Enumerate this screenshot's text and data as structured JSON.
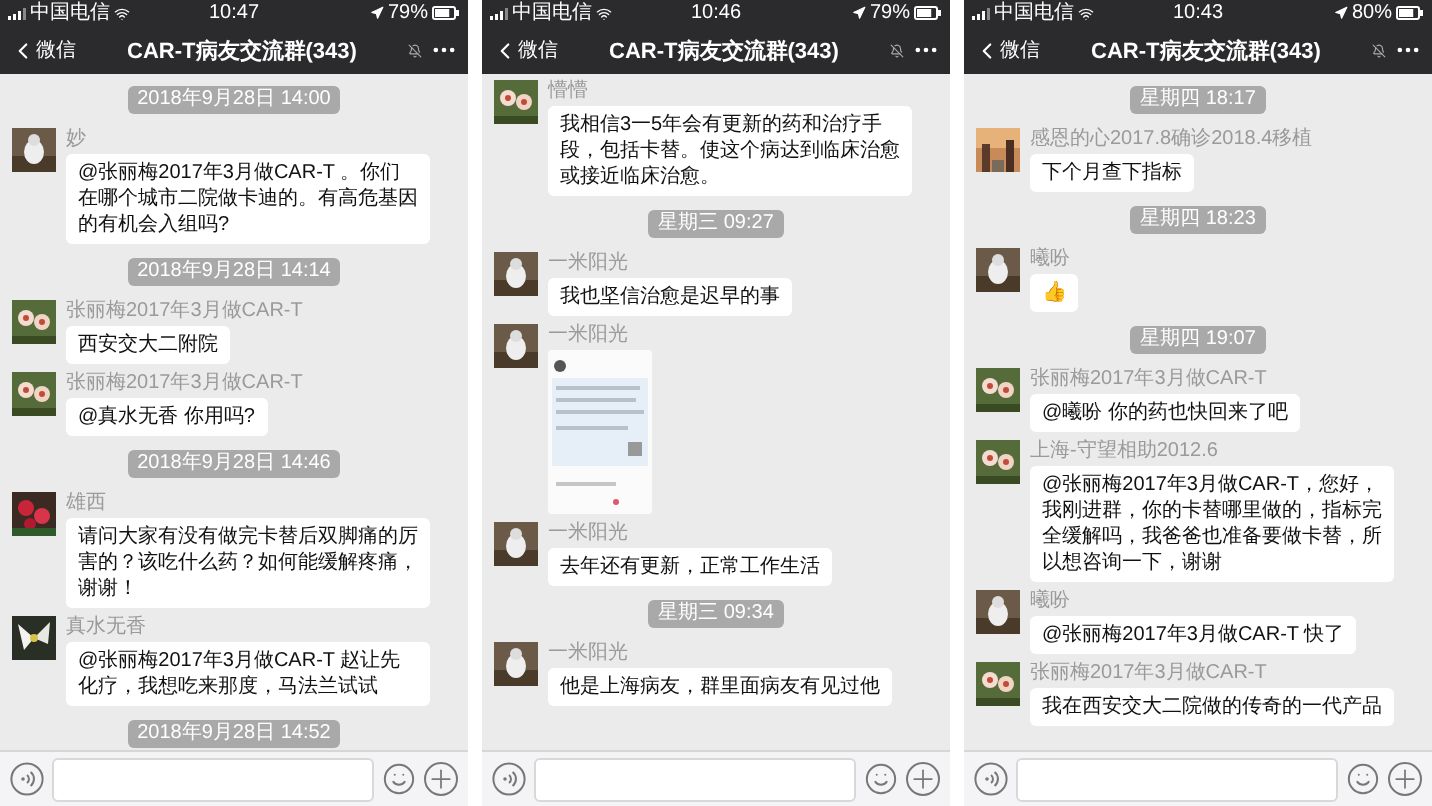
{
  "phones": [
    {
      "status_bar": {
        "carrier": "中国电信",
        "time": "10:47",
        "battery": "79%"
      },
      "nav": {
        "back": "微信",
        "title": "CAR-T病友交流群(343)"
      },
      "messages": [
        {
          "kind": "time",
          "text": "2018年9月28日 14:00"
        },
        {
          "kind": "text",
          "sender": "妙",
          "text": "@张丽梅2017年3月做CAR-T 。你们在哪个城市二院做卡迪的。有高危基因的有机会入组吗?"
        },
        {
          "kind": "time",
          "text": "2018年9月28日 14:14"
        },
        {
          "kind": "text",
          "sender": "张丽梅2017年3月做CAR-T",
          "text": "西安交大二附院"
        },
        {
          "kind": "text",
          "sender": "张丽梅2017年3月做CAR-T",
          "text": "@真水无香 你用吗?"
        },
        {
          "kind": "time",
          "text": "2018年9月28日 14:46"
        },
        {
          "kind": "text",
          "sender": "雄西",
          "text": "请问大家有没有做完卡替后双脚痛的厉害的？该吃什么药？如何能缓解疼痛，谢谢！"
        },
        {
          "kind": "text",
          "sender": "真水无香",
          "text": "@张丽梅2017年3月做CAR-T 赵让先化疗，我想吃来那度，马法兰试试"
        },
        {
          "kind": "time",
          "text": "2018年9月28日 14:52"
        }
      ]
    },
    {
      "status_bar": {
        "carrier": "中国电信",
        "time": "10:46",
        "battery": "79%"
      },
      "nav": {
        "back": "微信",
        "title": "CAR-T病友交流群(343)"
      },
      "messages": [
        {
          "kind": "text",
          "sender": "懵懵",
          "text": "我相信3一5年会有更新的药和治疗手段，包括卡替。使这个病达到临床治愈或接近临床治愈。"
        },
        {
          "kind": "time",
          "text": "星期三 09:27"
        },
        {
          "kind": "text",
          "sender": "一米阳光",
          "text": "我也坚信治愈是迟早的事"
        },
        {
          "sender": "一米阳光"
        },
        {
          "kind": "text",
          "sender": "一米阳光",
          "text": "去年还有更新，正常工作生活"
        },
        {
          "kind": "time",
          "text": "星期三 09:34"
        },
        {
          "kind": "text",
          "sender": "一米阳光",
          "text": "他是上海病友，群里面病友有见过他"
        }
      ]
    },
    {
      "status_bar": {
        "carrier": "中国电信",
        "time": "10:43",
        "battery": "80%"
      },
      "nav": {
        "back": "微信",
        "title": "CAR-T病友交流群(343)"
      },
      "messages": [
        {
          "kind": "time",
          "text": "星期四 18:17"
        },
        {
          "kind": "text",
          "sender": "感恩的心2017.8确诊2018.4移植",
          "text": "下个月查下指标"
        },
        {
          "kind": "time",
          "text": "星期四 18:23"
        },
        {
          "kind": "text",
          "sender": "曦吩",
          "text": "👍"
        },
        {
          "kind": "time",
          "text": "星期四 19:07"
        },
        {
          "kind": "text",
          "sender": "张丽梅2017年3月做CAR-T",
          "text": "@曦吩 你的药也快回来了吧"
        },
        {
          "kind": "text",
          "sender": "上海-守望相助2012.6",
          "text": "@张丽梅2017年3月做CAR-T，您好，我刚进群，你的卡替哪里做的，指标完全缓解吗，我爸爸也准备要做卡替，所以想咨询一下，谢谢"
        },
        {
          "kind": "text",
          "sender": "曦吩",
          "text": "@张丽梅2017年3月做CAR-T 快了"
        },
        {
          "kind": "text",
          "sender": "张丽梅2017年3月做CAR-T",
          "text": "我在西安交大二院做的传奇的一代产品"
        }
      ]
    }
  ]
}
